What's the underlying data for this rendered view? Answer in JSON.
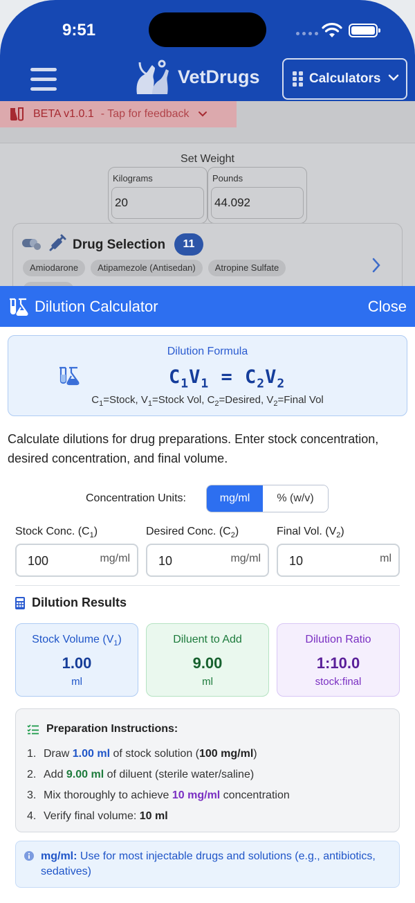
{
  "status": {
    "time": "9:51"
  },
  "header": {
    "app_name": "VetDrugs",
    "calculators_label": "Calculators"
  },
  "beta": {
    "version": "BETA v1.0.1",
    "tap": "- Tap for feedback"
  },
  "weight": {
    "title": "Set Weight",
    "kg_label": "Kilograms",
    "kg_value": "20",
    "lb_label": "Pounds",
    "lb_value": "44.092"
  },
  "drug_selection": {
    "title": "Drug Selection",
    "count": "11",
    "chips": [
      "Amiodarone",
      "Atipamezole (Antisedan)",
      "Atropine Sulfate"
    ]
  },
  "modal": {
    "title": "Dilution Calculator",
    "close": "Close"
  },
  "formula": {
    "title": "Dilution Formula"
  },
  "description": "Calculate dilutions for drug preparations. Enter stock concentration, desired concentration, and final volume.",
  "units": {
    "label": "Concentration Units:",
    "options": [
      "mg/ml",
      "% (w/v)"
    ],
    "selected": "mg/ml"
  },
  "inputs": {
    "stock": {
      "value": "100",
      "unit": "mg/ml"
    },
    "desired": {
      "value": "10",
      "unit": "mg/ml"
    },
    "final": {
      "value": "10",
      "unit": "ml"
    }
  },
  "results": {
    "title": "Dilution Results",
    "diluent": {
      "title": "Diluent to Add",
      "value": "9.00",
      "unit": "ml"
    },
    "stock_volume": {
      "value": "1.00",
      "unit": "ml"
    },
    "ratio": {
      "title": "Dilution Ratio",
      "value": "1:10.0",
      "unit": "stock:final"
    }
  },
  "preparation": {
    "title": "Preparation Instructions:",
    "step1": {
      "pre": "Draw ",
      "amount": "1.00 ml",
      "mid": " of stock solution (",
      "conc": "100 mg/ml",
      "post": ")"
    },
    "step2": {
      "pre": "Add ",
      "amount": "9.00 ml",
      "post": " of diluent (sterile water/saline)"
    },
    "step3": {
      "pre": "Mix thoroughly to achieve ",
      "conc": "10 mg/ml",
      "post": " concentration"
    },
    "step4": {
      "pre": "Verify final volume: ",
      "vol": "10 ml"
    }
  },
  "note": {
    "label": "mg/ml:",
    "text": " Use for most injectable drugs and solutions (e.g., antibiotics, sedatives)"
  },
  "colors": {
    "header": "#1648b3",
    "modal_bar": "#2d6ff0",
    "accent_blue": "#1f55c8",
    "accent_green": "#1d7b3c",
    "accent_purple": "#7a2fc2"
  }
}
